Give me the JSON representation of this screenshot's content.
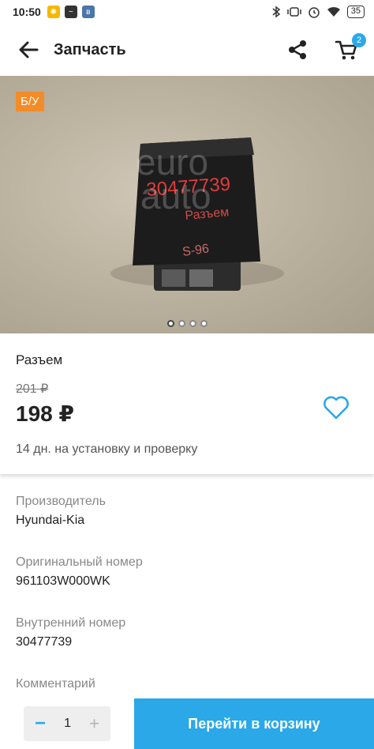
{
  "status_bar": {
    "time": "10:50",
    "battery": "35"
  },
  "app_bar": {
    "title": "Запчасть",
    "cart_count": "2"
  },
  "photo": {
    "condition_badge": "Б/У",
    "slides": 4,
    "active_slide": 1
  },
  "product": {
    "name": "Разъем",
    "old_price": "201 ₽",
    "price": "198 ₽",
    "delivery": "14 дн. на установку и проверку"
  },
  "details": [
    {
      "label": "Производитель",
      "value": "Hyundai-Kia"
    },
    {
      "label": "Оригинальный номер",
      "value": "961103W000WK"
    },
    {
      "label": "Внутренний номер",
      "value": "30477739"
    },
    {
      "label": "Комментарий",
      "value": ""
    }
  ],
  "bottom": {
    "quantity": "1",
    "minus": "−",
    "plus": "+",
    "cta_label": "Перейти в корзину"
  },
  "colors": {
    "accent": "#2aa8e8",
    "badge": "#f28c28"
  }
}
